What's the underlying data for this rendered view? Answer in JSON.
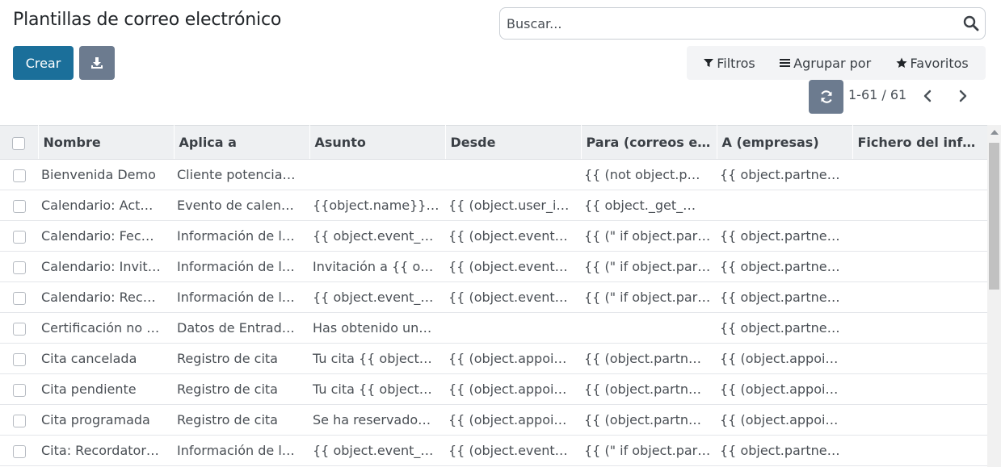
{
  "page": {
    "title": "Plantillas de correo electrónico"
  },
  "search": {
    "placeholder": "Buscar..."
  },
  "toolbar": {
    "create_label": "Crear"
  },
  "filters": {
    "filters_label": "Filtros",
    "group_label": "Agrupar por",
    "favorites_label": "Favoritos"
  },
  "pager": {
    "value": "1-61 / 61"
  },
  "columns": [
    "Nombre",
    "Aplica a",
    "Asunto",
    "Desde",
    "Para (correos e…",
    "A (empresas)",
    "Fichero del info…"
  ],
  "rows": [
    [
      "Bienvenida Demo",
      "Cliente potencia…",
      "",
      "",
      "{{ (not object.p…",
      "{{ object.partne…",
      ""
    ],
    [
      "Calendario: Act…",
      "Evento de calen…",
      "{{object.name}}…",
      "{{ (object.user_i…",
      "{{ object._get_…",
      "",
      ""
    ],
    [
      "Calendario: Fec…",
      "Información de l…",
      "{{ object.event_…",
      "{{ (object.event…",
      "{{ (\" if object.par…",
      "{{ object.partne…",
      ""
    ],
    [
      "Calendario: Invit…",
      "Información de l…",
      "Invitación a {{ o…",
      "{{ (object.event…",
      "{{ (\" if object.par…",
      "{{ object.partne…",
      ""
    ],
    [
      "Calendario: Rec…",
      "Información de l…",
      "{{ object.event_…",
      "{{ (object.event…",
      "{{ (\" if object.par…",
      "{{ object.partne…",
      ""
    ],
    [
      "Certificación no …",
      "Datos de Entrad…",
      "Has obtenido un…",
      "",
      "",
      "{{ object.partne…",
      ""
    ],
    [
      "Cita cancelada",
      "Registro de cita",
      "Tu cita {{ object…",
      "{{ (object.appoi…",
      "{{ (object.partn…",
      "{{ (object.appoi…",
      ""
    ],
    [
      "Cita pendiente",
      "Registro de cita",
      "Tu cita {{ object…",
      "{{ (object.appoi…",
      "{{ (object.partn…",
      "{{ (object.appoi…",
      ""
    ],
    [
      "Cita programada",
      "Registro de cita",
      "Se ha reservado…",
      "{{ (object.appoi…",
      "{{ (object.partn…",
      "{{ (object.appoi…",
      ""
    ],
    [
      "Cita: Recordator…",
      "Información de l…",
      "{{ object.event_…",
      "{{ (object.event…",
      "{{ (\" if object.par…",
      "{{ object.partne…",
      ""
    ]
  ],
  "colors": {
    "primary": "#1b6f9a",
    "secondary": "#6c7b8f",
    "header_bg": "#eef0f2"
  },
  "icons": {
    "search": "search-icon",
    "download": "download-icon",
    "filter": "filter-icon",
    "group": "list-icon",
    "favorites": "star-icon",
    "refresh": "refresh-icon",
    "prev": "chevron-left-icon",
    "next": "chevron-right-icon"
  }
}
